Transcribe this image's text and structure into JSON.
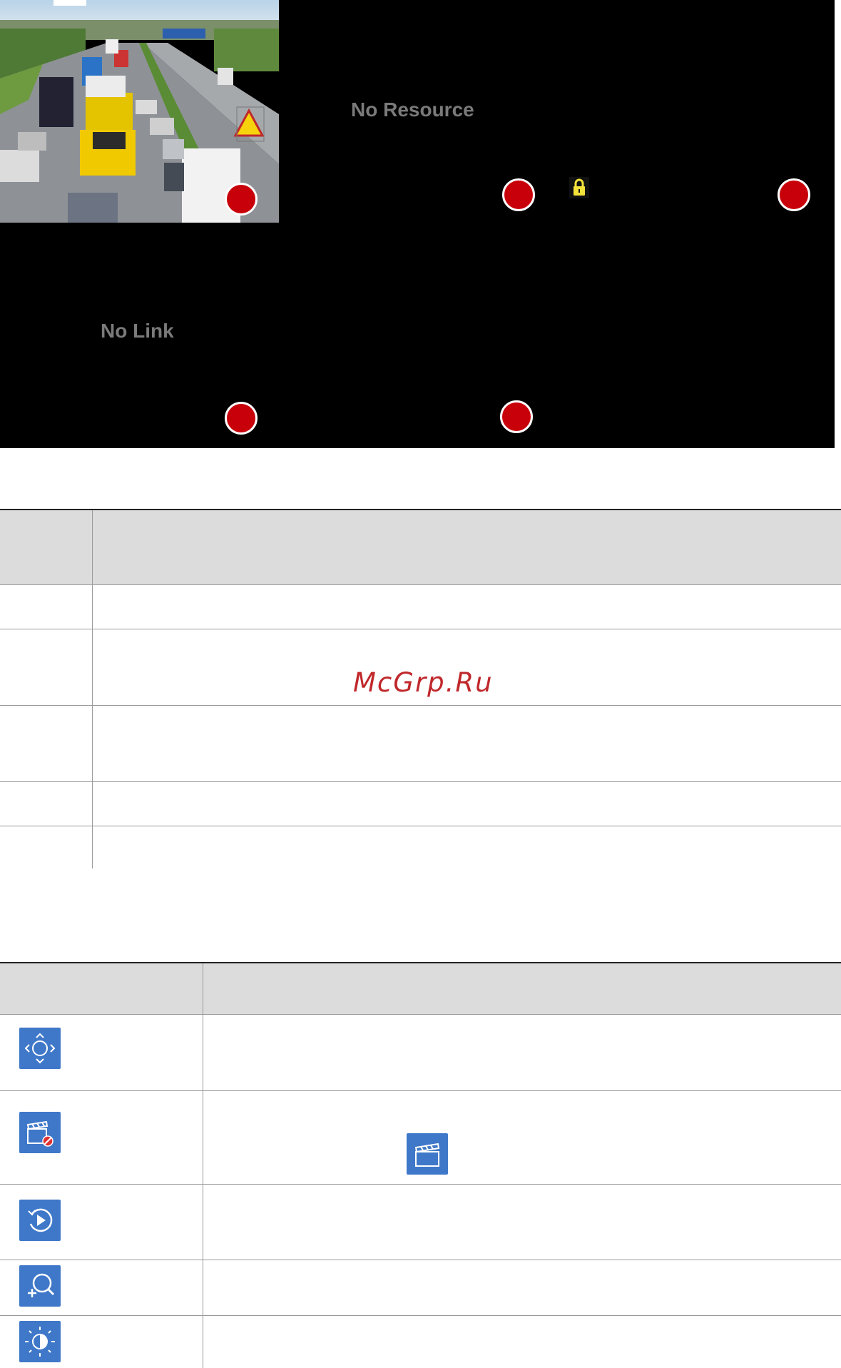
{
  "video_grid": {
    "cells": [
      {
        "name": "traffic-camera-view",
        "status_text": ""
      },
      {
        "name": "no-resource-window",
        "status_text": "No Resource"
      },
      {
        "name": "locked-window",
        "status_text": "",
        "icon": "lock-icon"
      },
      {
        "name": "no-link-window",
        "status_text": "No Link"
      },
      {
        "name": "empty-window-5",
        "status_text": ""
      },
      {
        "name": "empty-window-6",
        "status_text": ""
      }
    ],
    "marker_color": "#c8000a"
  },
  "watermark": "McGrp.Ru",
  "table1": {
    "headers": [
      "",
      ""
    ],
    "rows": [
      [
        "",
        ""
      ],
      [
        "",
        ""
      ],
      [
        "",
        ""
      ],
      [
        "",
        ""
      ],
      [
        "",
        ""
      ]
    ]
  },
  "table2": {
    "headers": [
      "",
      ""
    ],
    "rows": [
      {
        "icon": "ptz-control-icon",
        "description": ""
      },
      {
        "icon": "stop-recording-icon",
        "description": "",
        "inline_icon": "clapperboard-icon"
      },
      {
        "icon": "instant-playback-icon",
        "description": ""
      },
      {
        "icon": "zoom-in-icon",
        "description": ""
      },
      {
        "icon": "image-adjust-icon",
        "description": ""
      }
    ]
  },
  "colors": {
    "accent": "#3f78c8",
    "marker": "#c8000a",
    "header_bg": "#dcdcdc"
  }
}
